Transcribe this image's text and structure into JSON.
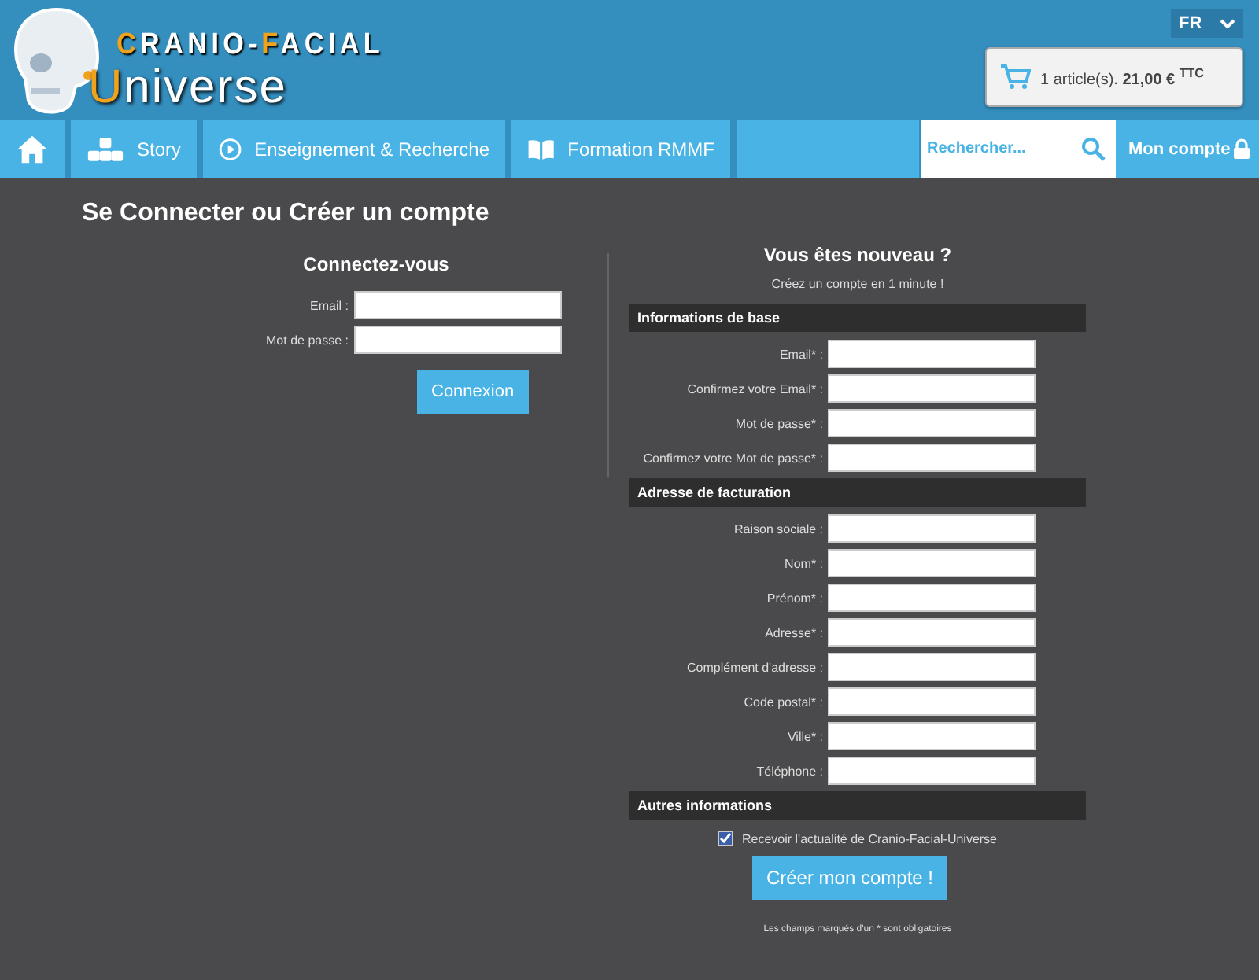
{
  "logo": {
    "line1": [
      {
        "text": "C",
        "accent": true
      },
      {
        "text": "RANIO-",
        "accent": false
      },
      {
        "text": "F",
        "accent": true
      },
      {
        "text": "ACIAL",
        "accent": false
      }
    ],
    "line2": [
      {
        "text": "U",
        "accent": true
      },
      {
        "text": "niverse",
        "accent": false
      }
    ]
  },
  "language": {
    "value": "FR"
  },
  "cart": {
    "summary": "1 article(s). **21,00 €** $^{TTC}$"
  },
  "nav": [
    {
      "kind": "home"
    },
    {
      "kind": "story",
      "label": "Story"
    },
    {
      "kind": "play",
      "label": "Enseignement & Recherche"
    },
    {
      "kind": "book",
      "label": "Formation RMMF"
    },
    {
      "kind": "spacer"
    }
  ],
  "search": {
    "placeholder": "Rechercher..."
  },
  "account": {
    "label": "Mon compte"
  },
  "page_title": "Se Connecter ou Créer un compte",
  "login": {
    "title": "Connectez-vous",
    "fields": [
      "Email :",
      "Mot de passe :"
    ],
    "button": "Connexion"
  },
  "register": {
    "title": "Vous êtes nouveau ?",
    "subtitle": "Créez un compte en 1 minute !",
    "sections": [
      {
        "title": "Informations de base",
        "fields": [
          "Email* :",
          "Confirmez votre Email* :",
          "Mot de passe* :",
          "Confirmez votre Mot de passe* :"
        ]
      },
      {
        "title": "Adresse de facturation",
        "fields": [
          "Raison sociale :",
          "Nom* :",
          "Prénom* :",
          "Adresse* :",
          "Complément d'adresse :",
          "Code postal* :",
          "Ville* :",
          "Téléphone :"
        ]
      },
      {
        "title": "Autres informations"
      }
    ],
    "newsletter": {
      "label": "Recevoir l'actualité de Cranio-Facial-Universe",
      "checked": true
    },
    "button": "Créer mon compte !",
    "footnote": "Les champs marqués d'un * sont obligatoires"
  }
}
